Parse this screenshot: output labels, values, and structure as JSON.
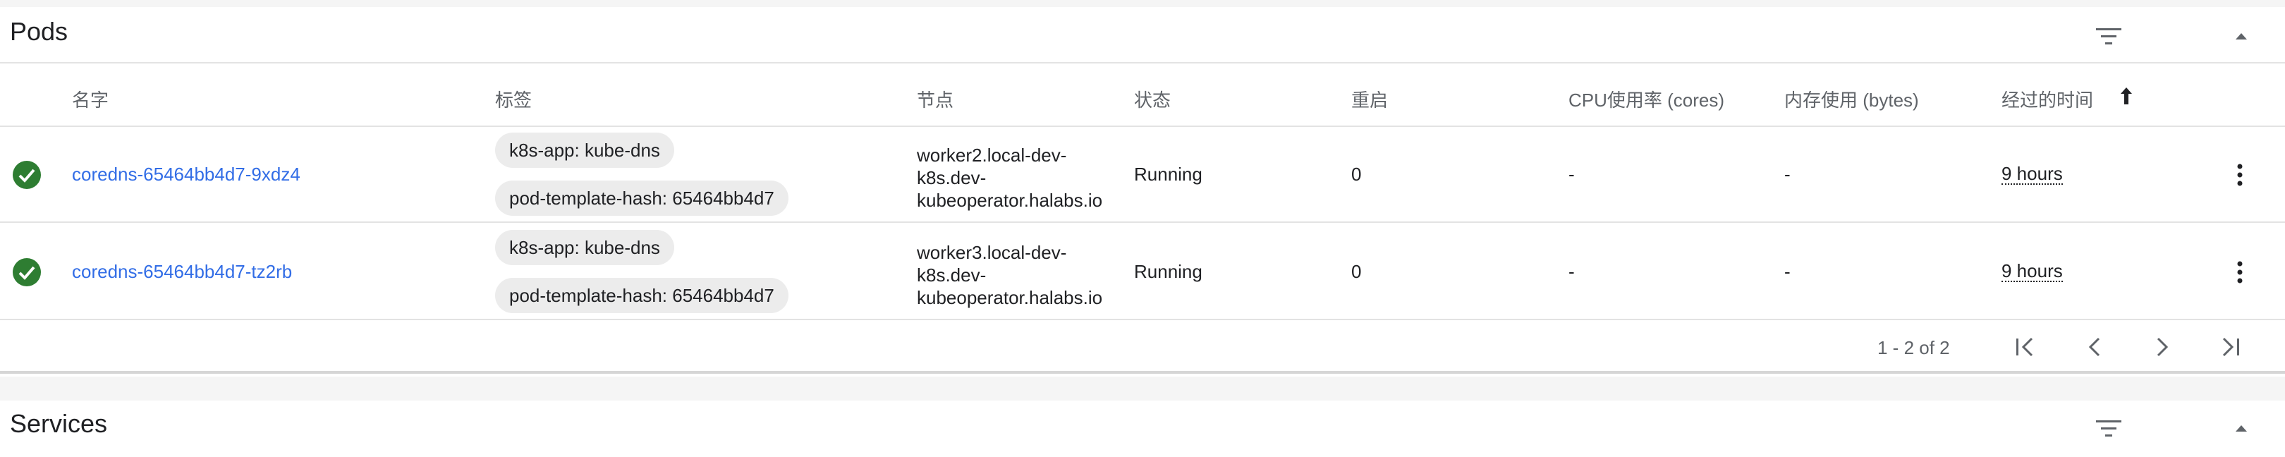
{
  "pods_card": {
    "title": "Pods",
    "filter_icon": "filter-icon",
    "collapse_icon": "collapse-arrow-icon"
  },
  "table": {
    "columns": {
      "name": "名字",
      "labels": "标签",
      "node": "节点",
      "status": "状态",
      "restarts": "重启",
      "cpu": "CPU使用率 (cores)",
      "memory": "内存使用 (bytes)",
      "age": "经过的时间"
    },
    "sort_icon": "arrow-up-icon",
    "rows": [
      {
        "status_icon": "check-circle-icon",
        "name": "coredns-65464bb4d7-9xdz4",
        "labels": [
          "k8s-app: kube-dns",
          "pod-template-hash: 65464bb4d7"
        ],
        "node_lines": [
          "worker2.local-dev-",
          "k8s.dev-",
          "kubeoperator.halabs.io"
        ],
        "status": "Running",
        "restarts": "0",
        "cpu": "-",
        "memory": "-",
        "age": "9 hours"
      },
      {
        "status_icon": "check-circle-icon",
        "name": "coredns-65464bb4d7-tz2rb",
        "labels": [
          "k8s-app: kube-dns",
          "pod-template-hash: 65464bb4d7"
        ],
        "node_lines": [
          "worker3.local-dev-",
          "k8s.dev-",
          "kubeoperator.halabs.io"
        ],
        "status": "Running",
        "restarts": "0",
        "cpu": "-",
        "memory": "-",
        "age": "9 hours"
      }
    ]
  },
  "paginator": {
    "range": "1 - 2 of 2"
  },
  "services_card": {
    "title": "Services"
  },
  "colors": {
    "link": "#326de6",
    "success": "#2e7d32",
    "chip_bg": "#ececec"
  }
}
